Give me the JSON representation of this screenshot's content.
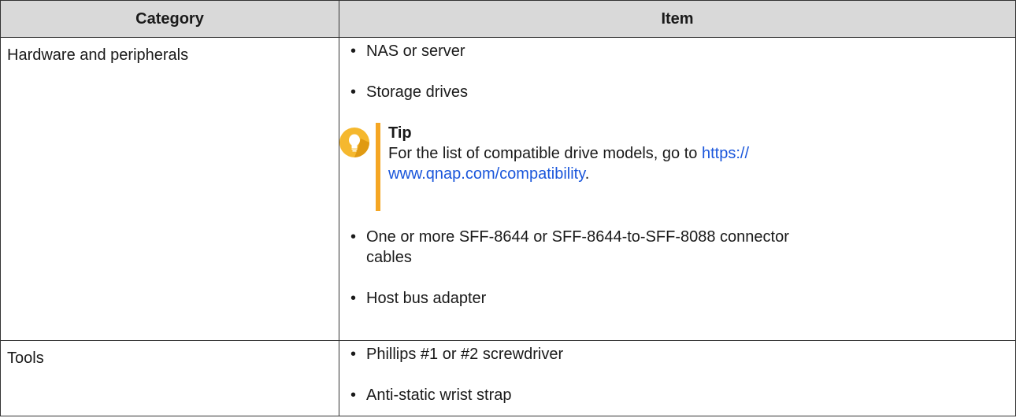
{
  "table": {
    "headers": {
      "category": "Category",
      "item": "Item"
    },
    "rows": [
      {
        "category": "Hardware and peripherals",
        "items": [
          "NAS or server",
          "Storage drives"
        ],
        "tip": {
          "title": "Tip",
          "text_before": "For the list of compatible drive models, go to ",
          "link_line1": "https://",
          "link_line2": "www.qnap.com/compatibility",
          "text_after": "."
        },
        "items_after": [
          "One or more SFF-8644 or SFF-8644-to-SFF-8088 connector",
          "cables",
          "Host bus adapter"
        ]
      },
      {
        "category": "Tools",
        "items": [
          "Phillips #1 or #2 screwdriver",
          "Anti-static wrist strap"
        ]
      }
    ]
  },
  "colors": {
    "tip_accent": "#f5a623",
    "link": "#1a56db",
    "header_bg": "#d9d9d9"
  },
  "icons": {
    "tip": "lightbulb-icon",
    "bullet": "bullet-dot"
  }
}
